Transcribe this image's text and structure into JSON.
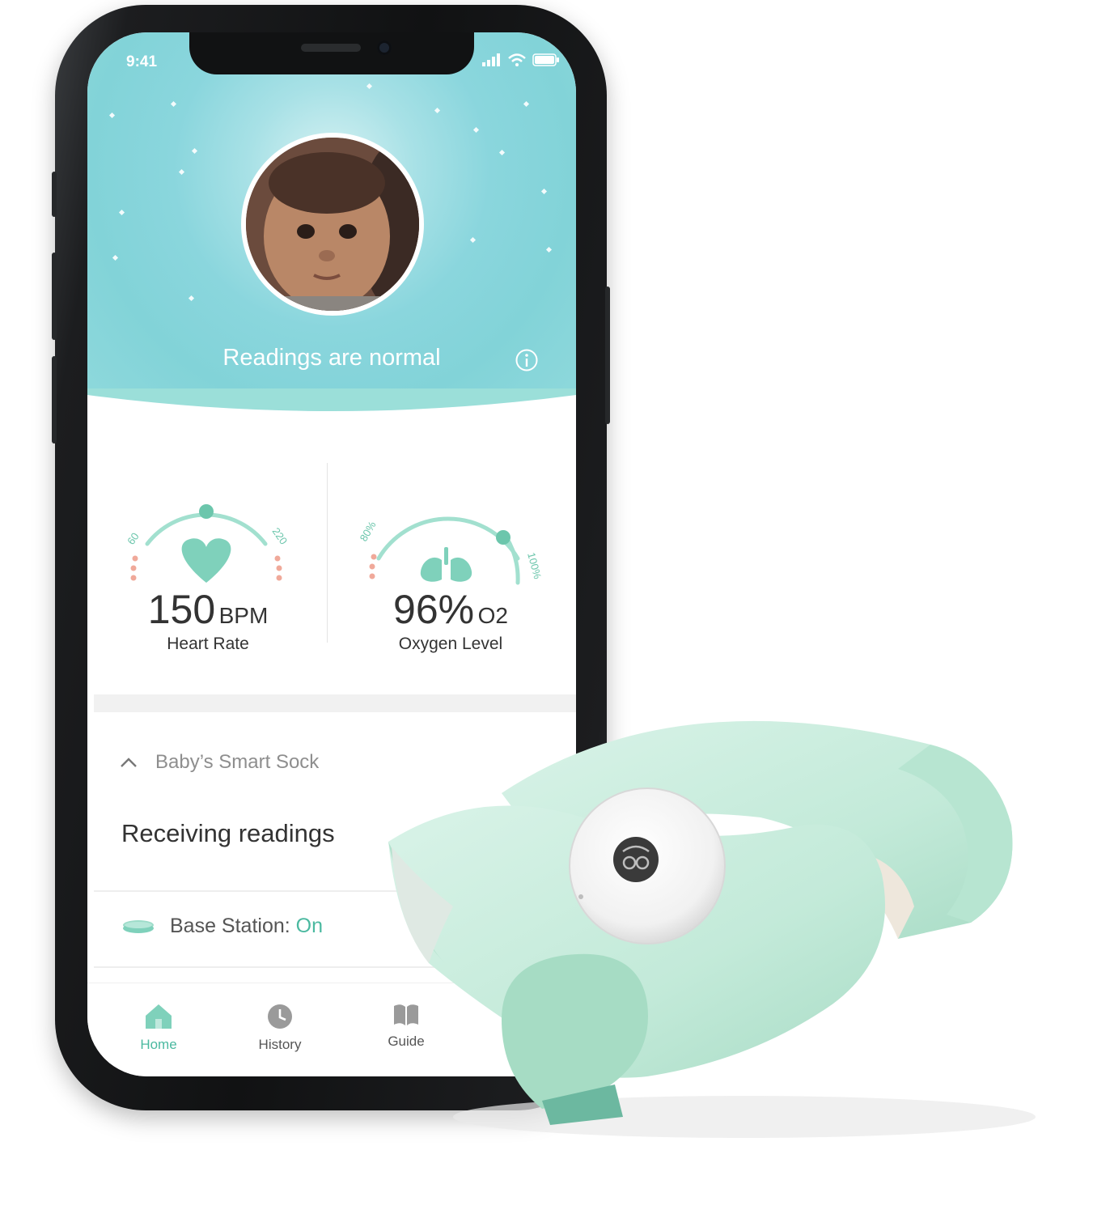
{
  "status_bar": {
    "time": "9:41"
  },
  "header": {
    "status_text": "Readings are normal"
  },
  "heart": {
    "min_label": "60",
    "max_label": "220",
    "value": "150",
    "unit": "BPM",
    "label": "Heart Rate"
  },
  "oxygen": {
    "min_label": "80%",
    "max_label": "100%",
    "value": "96%",
    "unit": "O2",
    "label": "Oxygen Level"
  },
  "sock_section": {
    "title": "Baby’s Smart Sock",
    "status": "Receiving readings"
  },
  "base_station": {
    "label": "Base Station:",
    "value": "On"
  },
  "tabs": [
    {
      "label": "Home",
      "icon": "home-icon",
      "active": true
    },
    {
      "label": "History",
      "icon": "clock-icon",
      "active": false
    },
    {
      "label": "Guide",
      "icon": "book-icon",
      "active": false
    }
  ],
  "colors": {
    "accent": "#4bb9a0",
    "header": "#8ad6dd",
    "gauge": "#9ddcc9",
    "alert_dots": "#f0a99a"
  }
}
